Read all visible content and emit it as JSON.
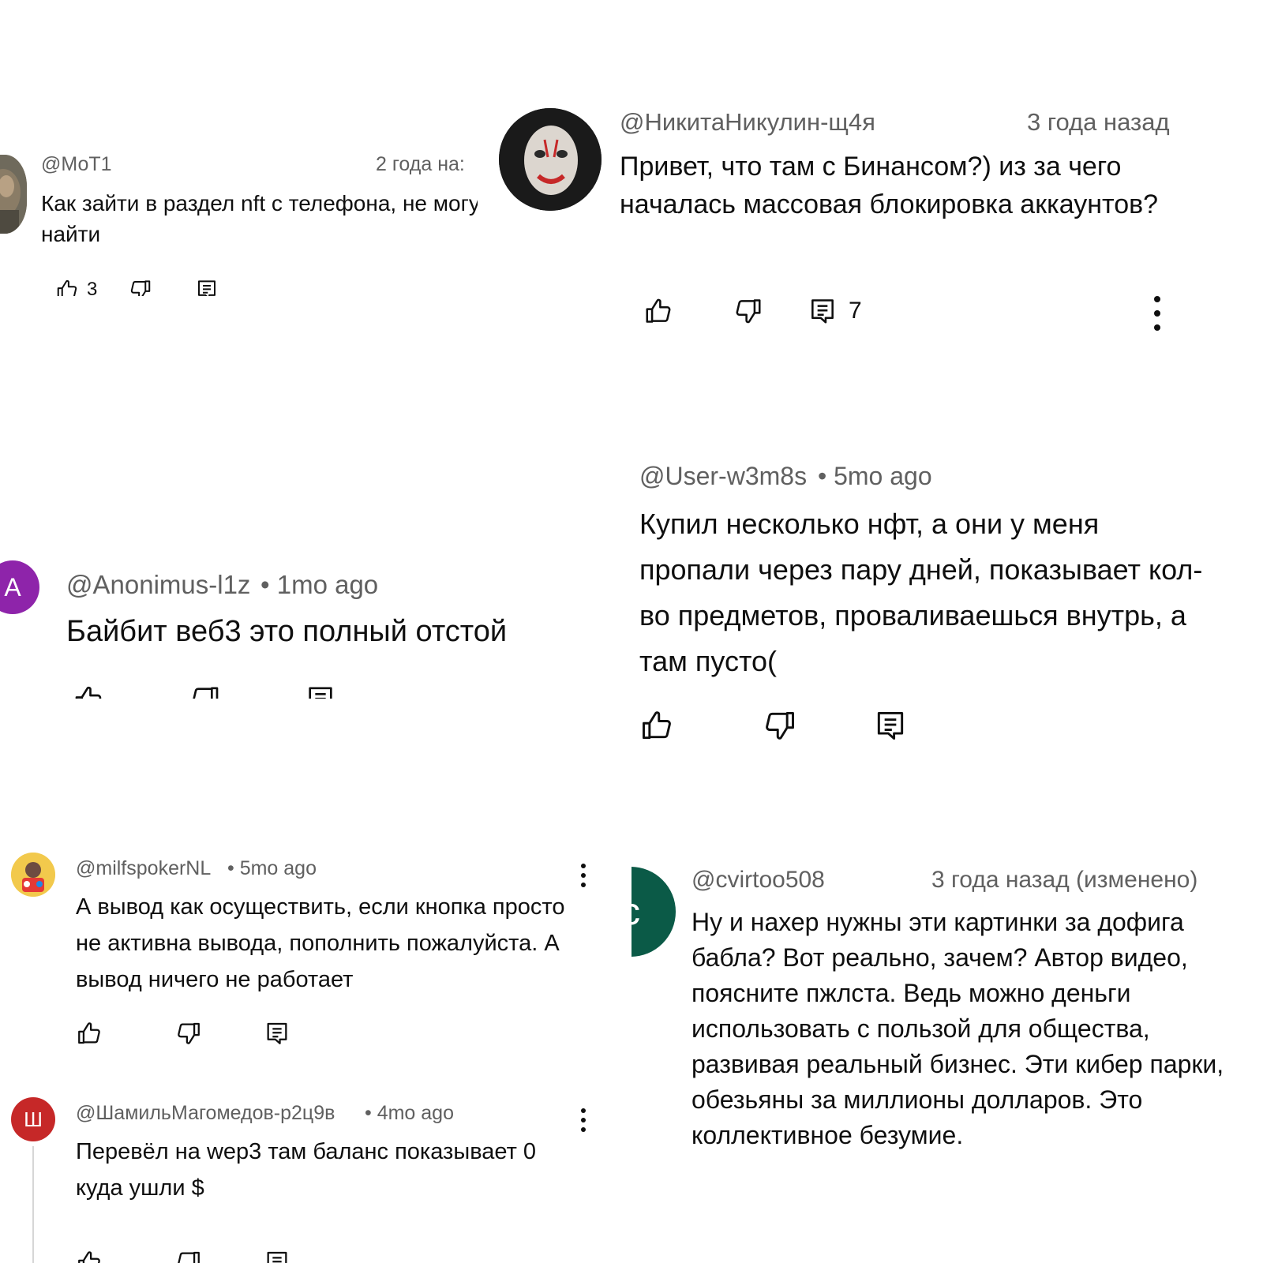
{
  "comments": [
    {
      "handle": "@МоТ1",
      "time": "2 года на:",
      "text": "Как зайти в раздел nft с телефона, не могу найти",
      "likes": "3",
      "icons": [
        "like-icon",
        "dislike-icon",
        "reply-icon"
      ]
    },
    {
      "handle": "@НикитаНикулин-щ4я",
      "time": "3 года назад",
      "text": "Привет, что там с Бинансом?) из за чего началась массовая блокировка аккаунтов?",
      "replies": "7",
      "icons": [
        "like-icon",
        "dislike-icon",
        "reply-icon",
        "more-vert-icon"
      ]
    },
    {
      "avatar_letter": "A",
      "avatar_color": "#8e24aa",
      "handle": "@Anonimus-l1z",
      "time": "• 1mo ago",
      "text": "Байбит веб3 это полный отстой",
      "icons": [
        "like-icon",
        "dislike-icon",
        "reply-icon"
      ]
    },
    {
      "handle": "@User-w3m8s",
      "time": "• 5mo ago",
      "text": "Купил несколько нфт, а они у меня пропали через пару дней, показывает кол-во предметов, проваливаешься внутрь, а там пусто(",
      "icons": [
        "like-icon",
        "dislike-icon",
        "reply-icon"
      ]
    },
    {
      "handle": "@milfspokerNL",
      "time": "• 5mo ago",
      "text": "А вывод как осуществить, если кнопка просто не активна вывода, пополнить пожалуйста. А вывод ничего не работает",
      "icons": [
        "like-icon",
        "dislike-icon",
        "reply-icon",
        "more-vert-icon"
      ]
    },
    {
      "avatar_letter": "Ш",
      "avatar_color": "#c62828",
      "handle": "@ШамильМагомедов-р2ц9в",
      "time": "• 4mo ago",
      "text": "Перевёл на wep3 там баланс показывает 0 куда ушли  $",
      "icons": [
        "like-icon",
        "dislike-icon",
        "reply-icon",
        "more-vert-icon"
      ]
    },
    {
      "avatar_letter": "c",
      "avatar_color": "#0b5a47",
      "handle": "@cvirtoo508",
      "time": "3 года назад (изменено)",
      "text": "Ну и нахер нужны эти картинки за дофига бабла? Вот реально, зачем? Автор видео, поясните пжлста. Ведь можно деньги использовать с пользой для общества, развивая реальный бизнес. Эти кибер парки, обезьяны за миллионы долларов. Это коллективное безумие."
    }
  ]
}
